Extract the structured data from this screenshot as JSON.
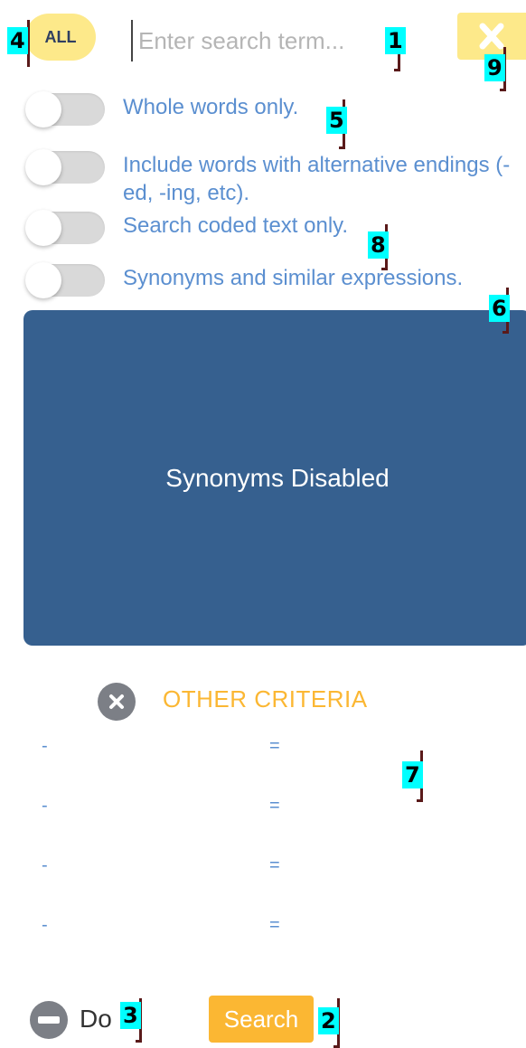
{
  "header": {
    "all_label": "ALL",
    "search_placeholder": "Enter search term...",
    "clear_icon": "close-icon"
  },
  "options": [
    {
      "label": "Whole words only.",
      "on": false
    },
    {
      "label": "Include words with alternative endings (-ed, -ing, etc).",
      "on": false
    },
    {
      "label": "Search coded text only.",
      "on": false
    },
    {
      "label": "Synonyms and similar expressions.",
      "on": false
    }
  ],
  "synonyms_panel": {
    "text": "Synonyms Disabled"
  },
  "other_criteria": {
    "title": "OTHER CRITERIA",
    "icon": "close-circle-icon",
    "rows": [
      {
        "left": "-",
        "op": "="
      },
      {
        "left": "-",
        "op": "="
      },
      {
        "left": "-",
        "op": "="
      },
      {
        "left": "-",
        "op": "="
      }
    ]
  },
  "footer": {
    "do_label": "Do",
    "do_icon": "minus-circle-icon",
    "search_label": "Search"
  },
  "annotations": [
    "1",
    "2",
    "3",
    "4",
    "5",
    "6",
    "7",
    "8",
    "9"
  ],
  "colors": {
    "accent_yellow": "#fde98a",
    "orange": "#fbb733",
    "panel_blue": "#36608f",
    "link_blue": "#5b8fd0",
    "tag_cyan": "#00ffff"
  }
}
